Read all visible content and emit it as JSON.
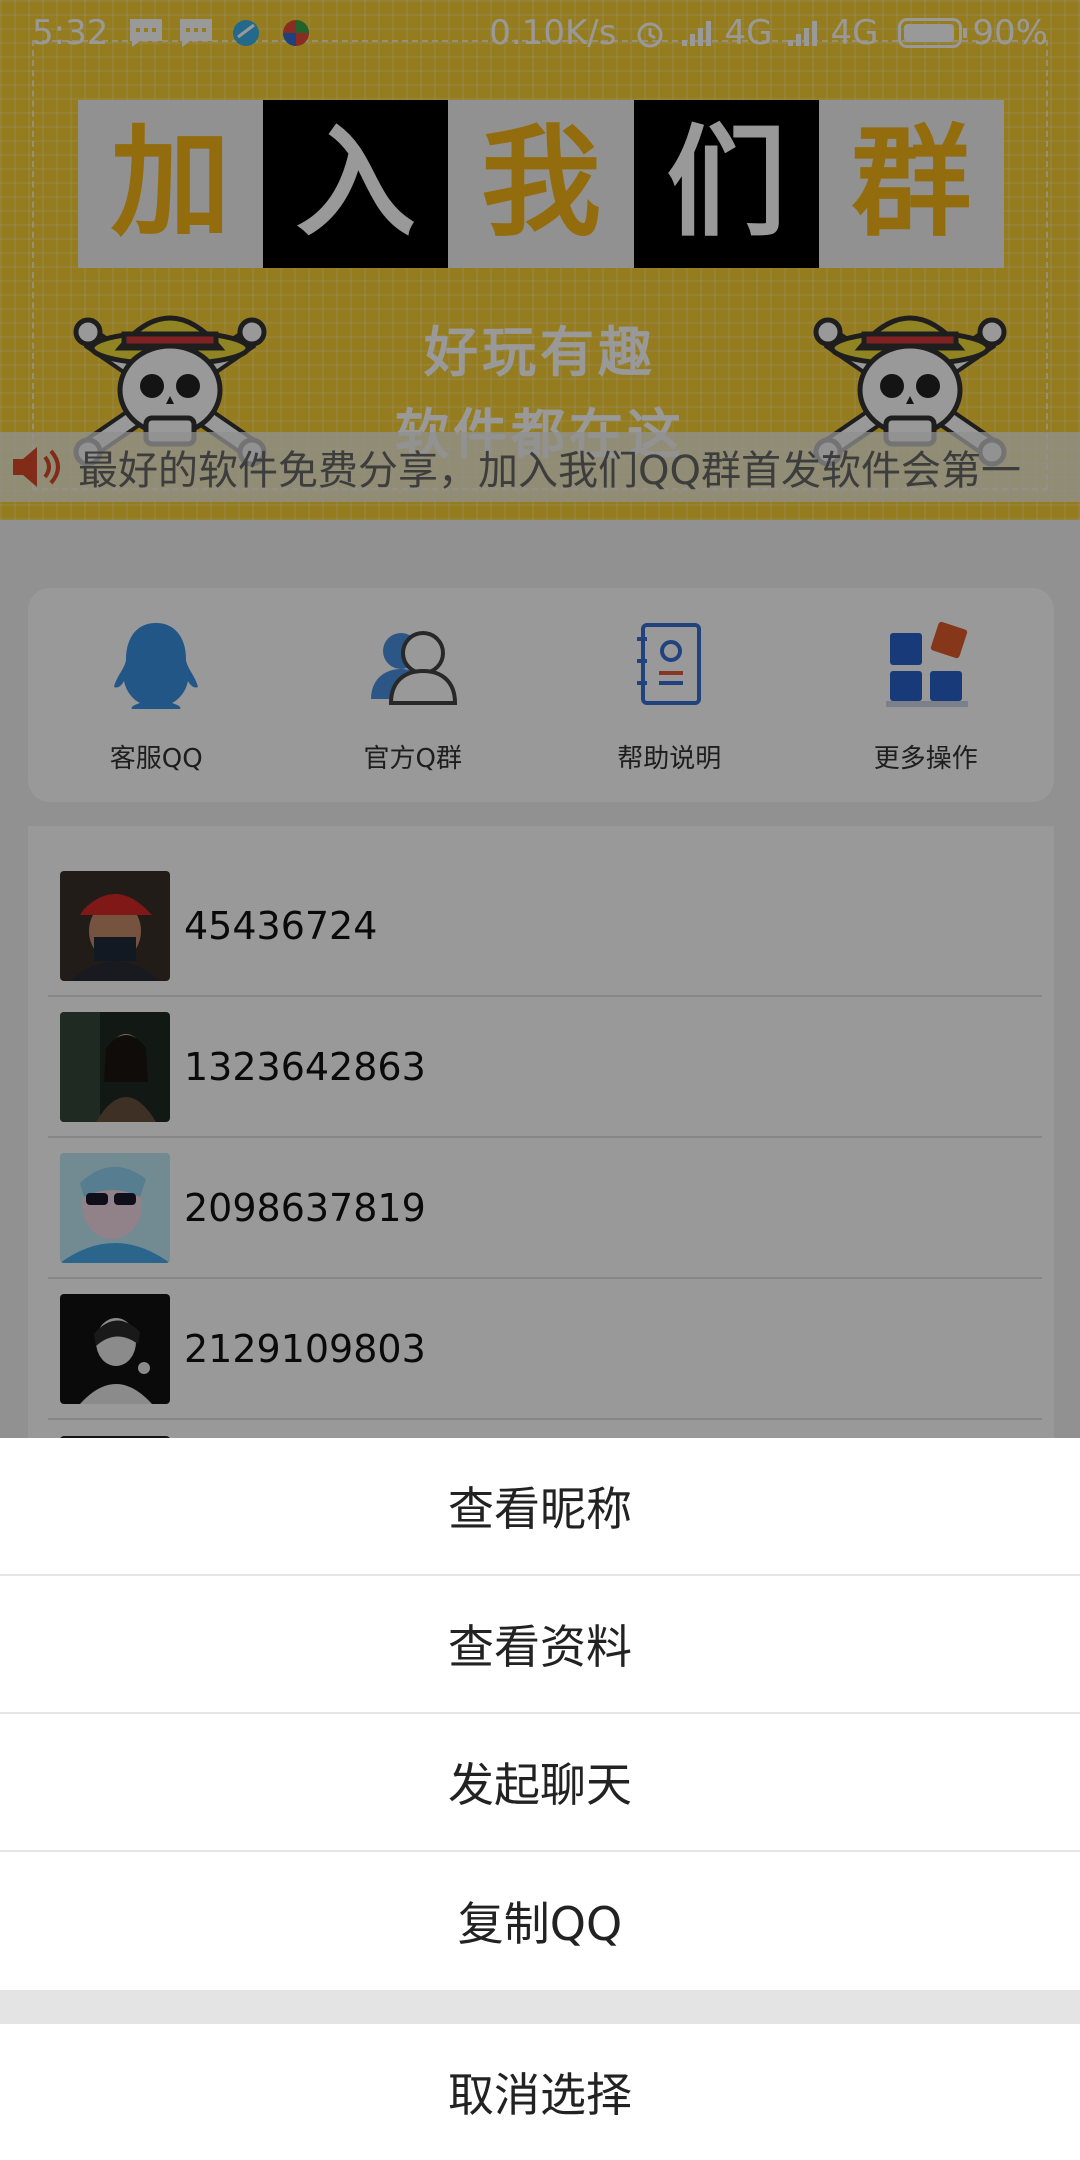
{
  "status_bar": {
    "time": "5:32",
    "network_speed": "0.10K/s",
    "network1": "4G",
    "network2": "4G",
    "battery": "90%",
    "icons": [
      "message-icon",
      "message-icon",
      "app-icon",
      "app-icon",
      "alarm-icon",
      "signal-icon",
      "battery-icon"
    ]
  },
  "banner": {
    "title_chars": [
      "加",
      "入",
      "我",
      "们",
      "群"
    ],
    "subtitle_line1": "好玩有趣",
    "subtitle_line2": "软件都在这",
    "marquee": "最好的软件免费分享，加入我们QQ群首发软件会第一",
    "accent_color": "#f8d135"
  },
  "quick_actions": [
    {
      "label": "客服QQ",
      "icon": "qq-penguin-icon"
    },
    {
      "label": "官方Q群",
      "icon": "group-icon"
    },
    {
      "label": "帮助说明",
      "icon": "help-document-icon"
    },
    {
      "label": "更多操作",
      "icon": "more-grid-icon"
    }
  ],
  "qq_list": [
    {
      "number": "45436724"
    },
    {
      "number": "1323642863"
    },
    {
      "number": "2098637819"
    },
    {
      "number": "2129109803"
    }
  ],
  "action_sheet": {
    "items": [
      "查看昵称",
      "查看资料",
      "发起聊天",
      "复制QQ"
    ],
    "cancel": "取消选择"
  }
}
